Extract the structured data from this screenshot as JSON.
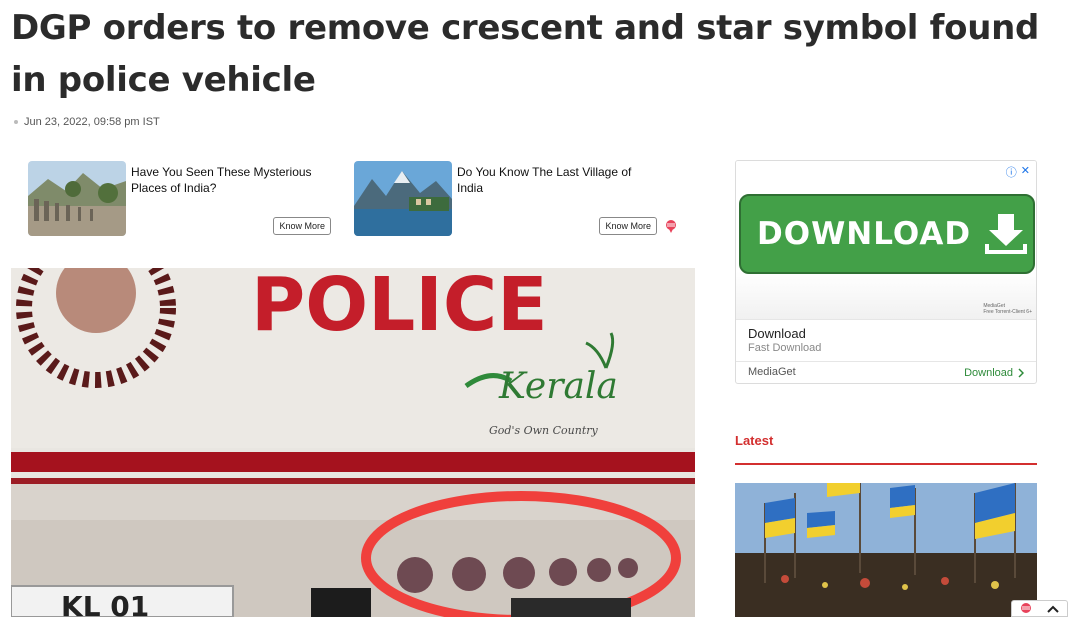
{
  "article": {
    "headline": "DGP orders to remove crescent and star symbol found in police vehicle",
    "date": "Jun 23, 2022, 09:58 pm IST"
  },
  "promos": [
    {
      "title": "Have You Seen These Mysterious Places of India?",
      "button": "Know More"
    },
    {
      "title": "Do You Know The Last Village of India",
      "button": "Know More"
    }
  ],
  "photo": {
    "vehicle_text": "POLICE",
    "logo_text": "Kerala",
    "logo_tagline": "God's Own Country",
    "plate_text": "KL 01"
  },
  "ad": {
    "banner_label": "DOWNLOAD",
    "small_print_1": "MediaGet",
    "small_print_2": "Free Torrent-Client 6+",
    "title": "Download",
    "subtitle": "Fast Download",
    "advertiser": "MediaGet",
    "cta": "Download",
    "info_icon": "info-icon",
    "close_icon": "close-icon"
  },
  "sidebar": {
    "latest_label": "Latest"
  },
  "colors": {
    "accent": "#d32f2f",
    "ad_green": "#43a048"
  }
}
